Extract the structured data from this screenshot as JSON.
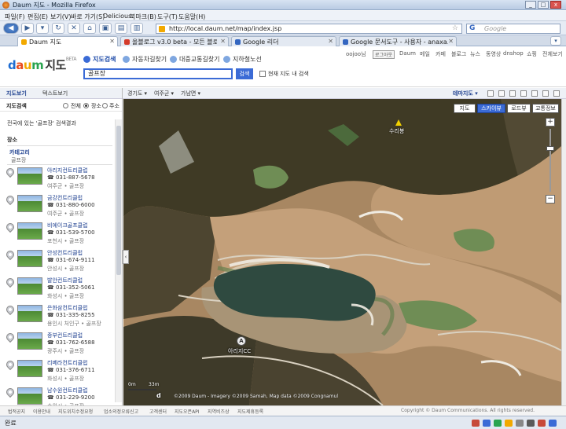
{
  "window": {
    "title": "Daum 지도 - Mozilla Firefox"
  },
  "menubar": [
    "파일(F)",
    "편집(E)",
    "보기(V)",
    "바로 가기(S)",
    "Delicious",
    "북마크(B)",
    "도구(T)",
    "도움말(H)"
  ],
  "nav": {
    "url": "http://local.daum.net/map/index.jsp",
    "search_placeholder": "Google"
  },
  "tabs": [
    {
      "label": "Daum 지도",
      "active": true,
      "color": "#f2a900"
    },
    {
      "label": "올블로그 v3.0 beta - 모든 블로거...",
      "active": false,
      "color": "#d43a2a"
    },
    {
      "label": "Google 리더",
      "active": false,
      "color": "#3466c0"
    },
    {
      "label": "Google 문서도구 - 사용자 - anaxa...",
      "active": false,
      "color": "#3466c0"
    }
  ],
  "header": {
    "logo_letters": [
      "d",
      "a",
      "u",
      "m"
    ],
    "logo_suffix": "지도",
    "logo_beta": "BETA",
    "modes": [
      {
        "label": "지도검색",
        "active": true,
        "color": "#3b6bd6"
      },
      {
        "label": "자동차길찾기",
        "active": false,
        "color": "#3b8bd6"
      },
      {
        "label": "대중교통길찾기",
        "active": false,
        "color": "#3b8bd6"
      },
      {
        "label": "지하철노선",
        "active": false,
        "color": "#3b8bd6"
      }
    ],
    "query": "골프장",
    "search_button": "검색",
    "map_only_label": "현재 지도 내 검색",
    "topnav": [
      "oojoo님",
      "로그아웃",
      "Daum",
      "메일",
      "카페",
      "블로그",
      "뉴스",
      "동영상",
      "dnshop",
      "쇼핑",
      "전체보기"
    ]
  },
  "sidebar": {
    "tabs": [
      "지도보기",
      "텍스트보기"
    ],
    "search_label": "지도검색",
    "radios": [
      {
        "label": "전체",
        "on": false
      },
      {
        "label": "장소",
        "on": true
      },
      {
        "label": "주소",
        "on": false
      }
    ],
    "result_header": "전국에 있는 '골프장' 검색결과",
    "section_title": "장소",
    "category_title": "카테고리",
    "category_value": "골프장",
    "results": [
      {
        "name": "아리지컨트리클럽",
        "phone": "☎ 031-887-5678",
        "addr": "여주군 • 골프장"
      },
      {
        "name": "금강컨트리클럽",
        "phone": "☎ 031-880-6000",
        "addr": "여주군 • 골프장"
      },
      {
        "name": "비에이크골프클럽",
        "phone": "☎ 031-539-5700",
        "addr": "포천시 • 골프장"
      },
      {
        "name": "안성컨트리클럽",
        "phone": "☎ 031-674-9111",
        "addr": "안성시 • 골프장"
      },
      {
        "name": "발안컨트리클럽",
        "phone": "☎ 031-352-5061",
        "addr": "화성시 • 골프장"
      },
      {
        "name": "은화삼컨트리클럽",
        "phone": "☎ 031-335-8255",
        "addr": "용인시 처인구 • 골프장"
      },
      {
        "name": "중부컨트리클럽",
        "phone": "☎ 031-762-6588",
        "addr": "광주시 • 골프장"
      },
      {
        "name": "리베라컨트리클럽",
        "phone": "☎ 031-376-6711",
        "addr": "화성시 • 골프장"
      },
      {
        "name": "남수원컨트리클럽",
        "phone": "☎ 031-229-9200",
        "addr": "수원시 • 골프장"
      }
    ]
  },
  "maptoolbar": {
    "breadcrumbs": [
      "경기도 ▾",
      "여주군 ▾",
      "가남면 ▾"
    ],
    "theme": "테마지도 ▾"
  },
  "map": {
    "types": [
      "지도",
      "스카이뷰",
      "로드뷰",
      "교통정보"
    ],
    "active_type": "스카이뷰",
    "label_peak": "수리봉",
    "poi_marker": "A",
    "poi_label": "아리지CC",
    "scale": [
      "0m",
      "33m"
    ],
    "copyright": "©2009 Daum - Imagery ©2009 Samah, Map data ©2009 Congnamul",
    "zoom_in": "+",
    "zoom_out": "−"
  },
  "footer": {
    "links": [
      "법적공지",
      "이용안내",
      "지도위치수정요청",
      "업소의정오류신고",
      "고객센터",
      "지도오픈API",
      "지역비즈상",
      "지도제휴등록"
    ],
    "copyright": "Copyright © Daum Communications. All rights reserved."
  },
  "status": {
    "text": "완료"
  }
}
